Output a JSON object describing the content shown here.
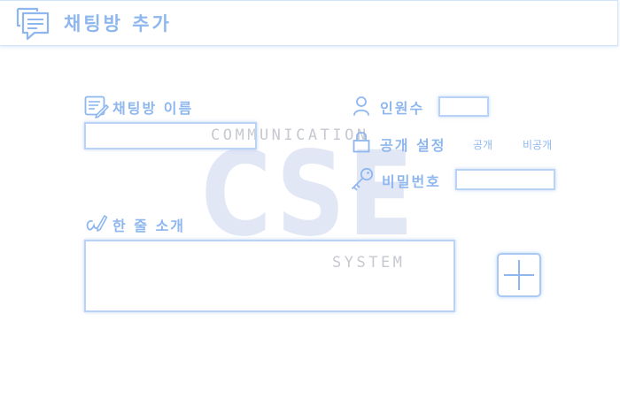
{
  "header": {
    "title": "채팅방 추가",
    "icon": "chat-bubbles-icon"
  },
  "watermark": {
    "top": "COMMUNICATION",
    "big": "CSE",
    "bottom": "SYSTEM"
  },
  "form": {
    "room_name": {
      "label": "채팅방 이름",
      "icon": "edit-document-icon",
      "value": ""
    },
    "intro": {
      "label": "한 줄 소개",
      "icon": "signature-pen-icon",
      "value": ""
    },
    "members": {
      "label": "인원수",
      "icon": "user-icon",
      "value": ""
    },
    "visibility": {
      "label": "공개 설정",
      "icon": "lock-icon",
      "options": [
        "공개",
        "비공개"
      ]
    },
    "password": {
      "label": "비밀번호",
      "icon": "key-icon",
      "value": ""
    },
    "add_button": {
      "icon": "plus-icon"
    }
  },
  "colors": {
    "accent": "#8fb7ef",
    "border": "#b9d3f6",
    "watermark_big": "#e2e7f6",
    "watermark_text": "#c6c9d0"
  }
}
